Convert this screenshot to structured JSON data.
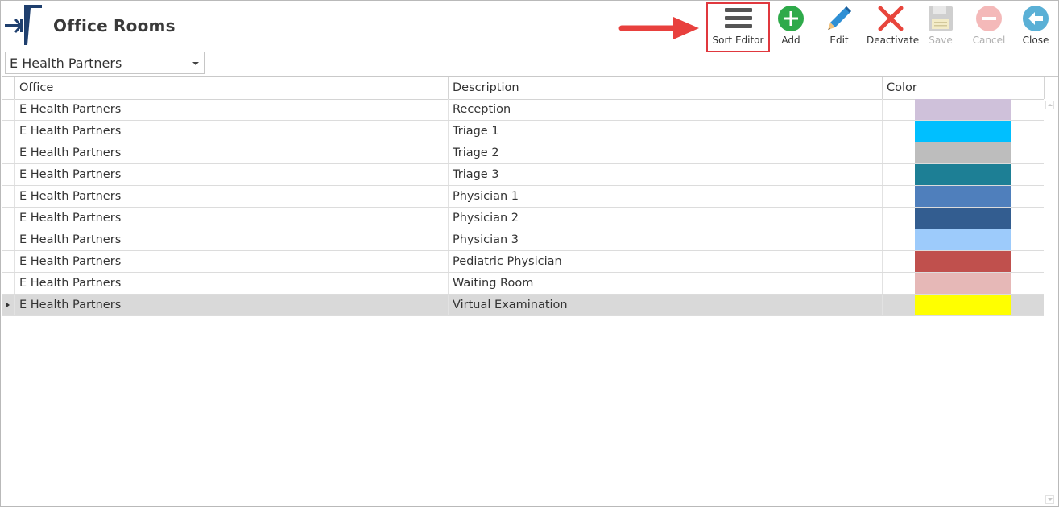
{
  "window": {
    "title": "Office Rooms"
  },
  "office_selector": {
    "value": "E Health Partners",
    "icon": "chevron-down-icon"
  },
  "toolbar": {
    "sort_editor": {
      "label": "Sort Editor",
      "icon": "hamburger-menu-icon"
    },
    "add": {
      "label": "Add",
      "icon": "plus-circle-icon",
      "color": "#2eaa4a"
    },
    "edit": {
      "label": "Edit",
      "icon": "pencil-icon",
      "color": "#2f8fd4"
    },
    "deactivate": {
      "label": "Deactivate",
      "icon": "x-icon",
      "color": "#e8453c"
    },
    "save": {
      "label": "Save",
      "icon": "floppy-disk-icon",
      "disabled": true
    },
    "cancel": {
      "label": "Cancel",
      "icon": "minus-circle-icon",
      "disabled": true
    },
    "close": {
      "label": "Close",
      "icon": "arrow-left-circle-icon",
      "color": "#5ab0d6"
    }
  },
  "table": {
    "columns": [
      "Office",
      "Description",
      "Color"
    ],
    "rows": [
      {
        "office": "E Health Partners",
        "description": "Reception",
        "color": "#cfc1da"
      },
      {
        "office": "E Health Partners",
        "description": "Triage 1",
        "color": "#00bfff"
      },
      {
        "office": "E Health Partners",
        "description": "Triage 2",
        "color": "#bdbdbd"
      },
      {
        "office": "E Health Partners",
        "description": "Triage 3",
        "color": "#1d7f95"
      },
      {
        "office": "E Health Partners",
        "description": "Physician 1",
        "color": "#4f7fbc"
      },
      {
        "office": "E Health Partners",
        "description": "Physician 2",
        "color": "#335d90"
      },
      {
        "office": "E Health Partners",
        "description": "Physician 3",
        "color": "#9dcbfb"
      },
      {
        "office": "E Health Partners",
        "description": "Pediatric Physician",
        "color": "#c0504d"
      },
      {
        "office": "E Health Partners",
        "description": "Waiting Room",
        "color": "#e6b8b7"
      },
      {
        "office": "E Health Partners",
        "description": "Virtual Examination",
        "color": "#ffff00"
      }
    ],
    "selected_row": 9
  }
}
